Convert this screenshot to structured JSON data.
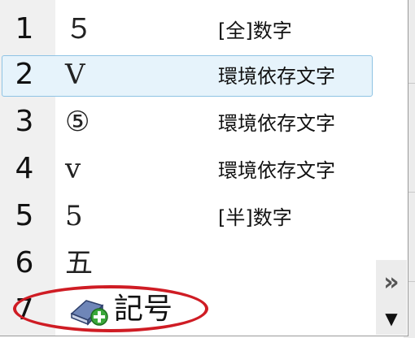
{
  "candidates": [
    {
      "num": "1",
      "text": "５",
      "category": "[全]数字"
    },
    {
      "num": "2",
      "text": "Ⅴ",
      "category": "環境依存文字",
      "selected": true
    },
    {
      "num": "3",
      "text": "⑤",
      "category": "環境依存文字"
    },
    {
      "num": "4",
      "text": "ⅴ",
      "category": "環境依存文字"
    },
    {
      "num": "5",
      "text": "5",
      "category": "[半]数字"
    },
    {
      "num": "6",
      "text": "五",
      "category": ""
    }
  ],
  "symbol_entry": {
    "num": "7",
    "label": "記号",
    "icon": "symbol-book-plus-icon"
  },
  "controls": {
    "expand_glyph": "»",
    "scroll_down_glyph": "▼"
  },
  "colors": {
    "selection_bg": "#e6f3fb",
    "selection_border": "#8fc3e4",
    "annotation_ellipse": "#cf1c24"
  }
}
